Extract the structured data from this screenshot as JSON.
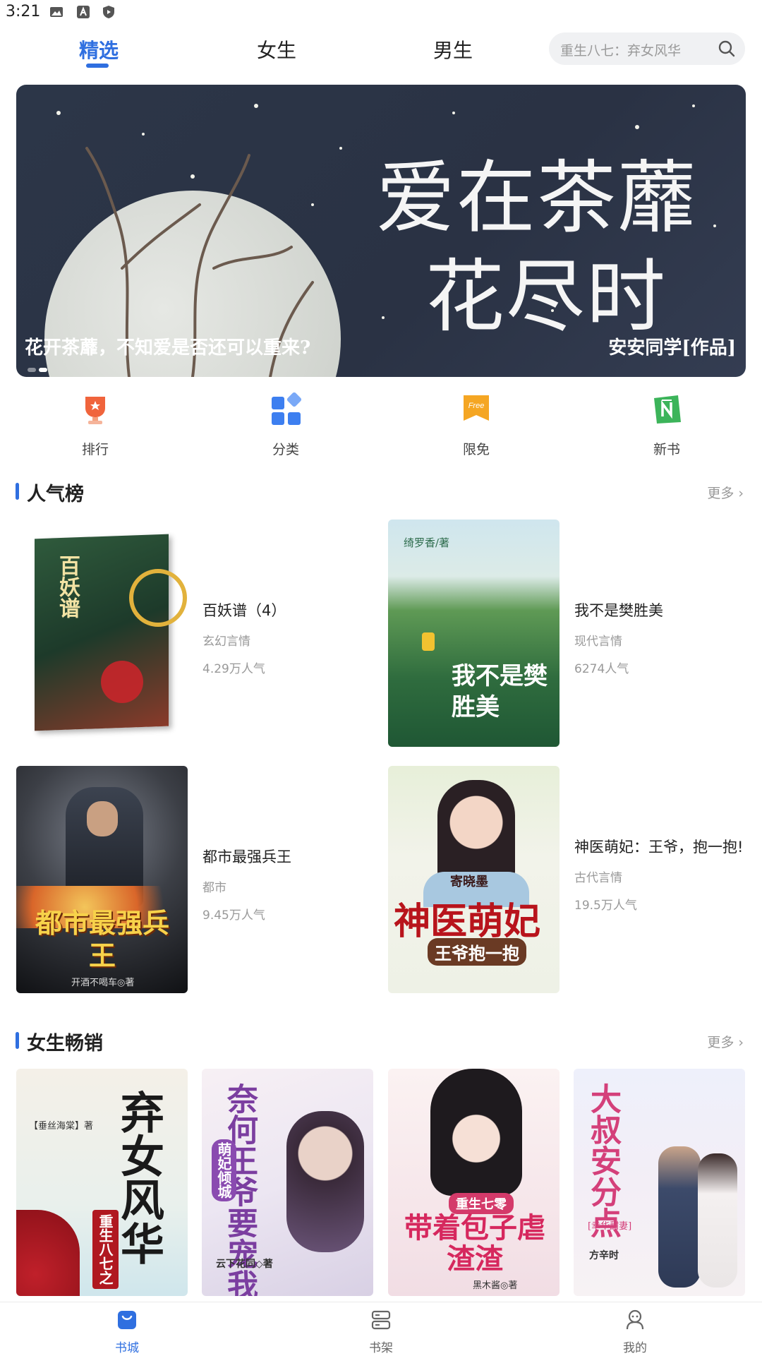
{
  "status_bar": {
    "time": "3:21"
  },
  "tabs": [
    {
      "label": "精选",
      "active": true
    },
    {
      "label": "女生",
      "active": false
    },
    {
      "label": "男生",
      "active": false
    }
  ],
  "search": {
    "placeholder": "重生八七：弃女风华"
  },
  "banner": {
    "title_line1": "爱在茶蘼",
    "title_line2": "花尽时",
    "subtitle": "花开茶蘼，不知爱是否还可以重来?",
    "author": "安安同学[作品]"
  },
  "quick_entries": [
    {
      "label": "排行",
      "icon": "trophy-icon",
      "color": "#f0643c"
    },
    {
      "label": "分类",
      "icon": "category-grid-icon",
      "color": "#3d7ff0"
    },
    {
      "label": "限免",
      "icon": "free-tag-icon",
      "color": "#f5a623"
    },
    {
      "label": "新书",
      "icon": "new-book-icon",
      "color": "#3cb45a"
    }
  ],
  "popular": {
    "title": "人气榜",
    "more": "更多 ›",
    "books": [
      {
        "name": "百妖谱（4）",
        "category": "玄幻言情",
        "popularity": "4.29万人气",
        "cover_text": "百妖谱"
      },
      {
        "name": "我不是樊胜美",
        "category": "现代言情",
        "popularity": "6274人气",
        "cover_text": "我不是樊胜美",
        "cover_author": "绮罗香/著"
      },
      {
        "name": "都市最强兵王",
        "category": "都市",
        "popularity": "9.45万人气",
        "cover_text": "都市最强兵王",
        "cover_author": "开酒不喝车◎著"
      },
      {
        "name": "神医萌妃：王爷，抱一抱!",
        "category": "古代言情",
        "popularity": "19.5万人气",
        "cover_text": "神医萌妃",
        "cover_sub": "王爷抱一抱",
        "cover_author": "寄晓墨"
      }
    ]
  },
  "women": {
    "title": "女生畅销",
    "more": "更多 ›",
    "covers": [
      {
        "text": "弃女风华",
        "sub": "重生八七之",
        "author": "【垂丝海棠】著"
      },
      {
        "text": "奈何王爷要宠我",
        "sub": "萌妃倾城",
        "author": "云下花同◇著"
      },
      {
        "text": "带着包子虐渣渣",
        "sub": "重生七零",
        "author": "黑木酱◎著"
      },
      {
        "text": "大叔安分点",
        "sub": "[幸华甜妻]",
        "author": "方辛时"
      }
    ]
  },
  "bottom_nav": [
    {
      "label": "书城",
      "icon": "bookstore-icon",
      "active": true
    },
    {
      "label": "书架",
      "icon": "bookshelf-icon",
      "active": false
    },
    {
      "label": "我的",
      "icon": "profile-icon",
      "active": false
    }
  ],
  "colors": {
    "accent": "#2f6fe0",
    "muted": "#999999"
  }
}
